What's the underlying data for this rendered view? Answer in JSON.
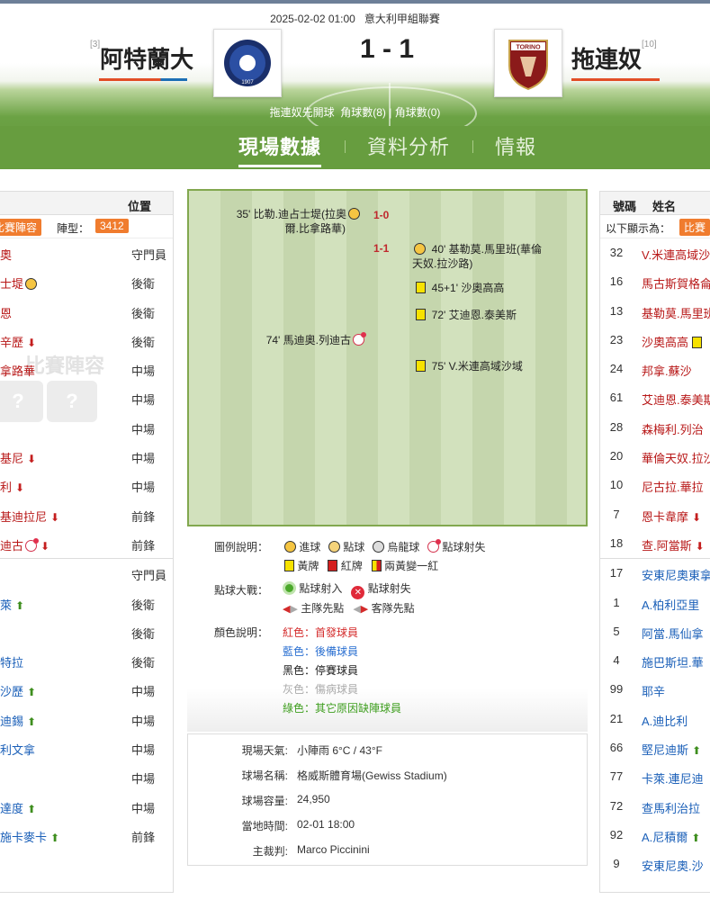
{
  "match": {
    "datetime": "2025-02-02 01:00",
    "league": "意大利甲組聯賽",
    "home": {
      "name": "阿特蘭大",
      "rank": "[3]"
    },
    "away": {
      "name": "拖連奴",
      "rank": "[10]"
    },
    "score": "1 - 1",
    "kickoff": "拖連奴先開球",
    "corners_home": "角球數(8)",
    "corners_away": "角球數(0)"
  },
  "tabs": [
    "現場數據",
    "資料分析",
    "情報"
  ],
  "left_panel": {
    "col_position": "位置",
    "lineup_tag": "比賽陣容",
    "formation_label": "陣型：",
    "formation": "3412",
    "ghost_text": "比賽陣容",
    "starters": [
      {
        "name": "奧",
        "pos": "守門員"
      },
      {
        "name": "士堤",
        "pos": "後衛",
        "icon": "goal"
      },
      {
        "name": "恩",
        "pos": "後衛"
      },
      {
        "name": "辛歷",
        "pos": "後衛",
        "sub": "down"
      },
      {
        "name": "拿路華",
        "pos": "中場"
      },
      {
        "name": "",
        "pos": "中場"
      },
      {
        "name": "",
        "pos": "中場"
      },
      {
        "name": "基尼",
        "pos": "中場",
        "sub": "down"
      },
      {
        "name": "利",
        "pos": "中場",
        "sub": "down"
      },
      {
        "name": "基迪拉尼",
        "pos": "前鋒",
        "sub": "down"
      },
      {
        "name": "迪古",
        "pos": "前鋒",
        "icon": "penmiss",
        "sub": "down"
      }
    ],
    "subs": [
      {
        "name": "",
        "pos": "守門員"
      },
      {
        "name": "萊",
        "pos": "後衛",
        "sub": "up"
      },
      {
        "name": "",
        "pos": "後衛"
      },
      {
        "name": "特拉",
        "pos": "後衛"
      },
      {
        "name": "沙歷",
        "pos": "中場",
        "sub": "up"
      },
      {
        "name": "迪錫",
        "pos": "中場",
        "sub": "up"
      },
      {
        "name": "利文拿",
        "pos": "中場"
      },
      {
        "name": "",
        "pos": "中場"
      },
      {
        "name": "達度",
        "pos": "中場",
        "sub": "up"
      },
      {
        "name": "施卡麥卡",
        "pos": "前鋒",
        "sub": "up"
      }
    ]
  },
  "timeline": {
    "events": [
      {
        "side": "home",
        "text": "35' 比勒.迪占士堤(拉奧",
        "text2": "爾.比拿路華)",
        "icon": "goal"
      },
      {
        "side": "home",
        "text": "74' 馬迪奧.列迪古",
        "icon": "penmiss"
      },
      {
        "side": "away",
        "text": "40' 基勒莫.馬里班(華倫",
        "text2": "天奴.拉沙路)",
        "icon": "goal"
      },
      {
        "side": "away",
        "text": "45+1' 沙奧高高",
        "icon": "yellow"
      },
      {
        "side": "away",
        "text": "72' 艾迪恩.泰美斯",
        "icon": "yellow"
      },
      {
        "side": "away",
        "text": "75' V.米連高域沙域",
        "icon": "yellow"
      }
    ],
    "scores": [
      "1-0",
      "1-1"
    ]
  },
  "legend": {
    "title": "圖例說明：",
    "goal": "進球",
    "penalty": "點球",
    "own_goal": "烏龍球",
    "pen_miss": "點球射失",
    "yellow": "黃牌",
    "red": "紅牌",
    "two_yellow": "兩黃變一紅",
    "shootout_title": "點球大戰：",
    "pen_in": "點球射入",
    "pen_out": "點球射失",
    "home_first": "主隊先點",
    "away_first": "客隊先點",
    "color_title": "顏色說明：",
    "red_desc": "紅色：首發球員",
    "blue_desc": "藍色：後備球員",
    "black_desc": "黑色：停賽球員",
    "grey_desc": "灰色：傷病球員",
    "green_desc": "綠色：其它原因缺陣球員",
    "colors": {
      "red": "#d42b2b",
      "blue": "#2a6fd1",
      "black": "#222222",
      "grey": "#aaaaaa",
      "green": "#3e9e1e"
    }
  },
  "info": [
    {
      "k": "現場天氣:",
      "v": "小陣雨  6°C / 43°F"
    },
    {
      "k": "球場名稱:",
      "v": "格威斯體育場(Gewiss Stadium)"
    },
    {
      "k": "球場容量:",
      "v": "24,950"
    },
    {
      "k": "當地時間:",
      "v": "02-01 18:00"
    },
    {
      "k": "主裁判:",
      "v": "Marco Piccinini"
    }
  ],
  "right_panel": {
    "col_no": "號碼",
    "col_name": "姓名",
    "note": "以下顯示為：",
    "note_tag": "比賽",
    "starters": [
      {
        "no": "32",
        "name": "V.米連高域沙"
      },
      {
        "no": "16",
        "name": "馬古斯賀格侖"
      },
      {
        "no": "13",
        "name": "基勒莫.馬里班"
      },
      {
        "no": "23",
        "name": "沙奧高高",
        "icon": "yellow"
      },
      {
        "no": "24",
        "name": "邦拿.蘇沙"
      },
      {
        "no": "61",
        "name": "艾迪恩.泰美斯"
      },
      {
        "no": "28",
        "name": "森梅利.列治"
      },
      {
        "no": "20",
        "name": "華倫天奴.拉沙"
      },
      {
        "no": "10",
        "name": "尼古拉.華拉"
      },
      {
        "no": "7",
        "name": "恩卡韋摩",
        "sub": "down"
      },
      {
        "no": "18",
        "name": "查.阿當斯",
        "sub": "down"
      }
    ],
    "subs": [
      {
        "no": "17",
        "name": "安東尼奧東拿"
      },
      {
        "no": "1",
        "name": "A.柏利亞里"
      },
      {
        "no": "5",
        "name": "阿當.馬仙拿"
      },
      {
        "no": "4",
        "name": "施巴斯坦.華"
      },
      {
        "no": "99",
        "name": "耶辛"
      },
      {
        "no": "21",
        "name": "A.迪比利"
      },
      {
        "no": "66",
        "name": "堅尼迪斯",
        "sub": "up"
      },
      {
        "no": "77",
        "name": "卡萊.連尼迪"
      },
      {
        "no": "72",
        "name": "查馬利治拉"
      },
      {
        "no": "92",
        "name": "A.尼積爾",
        "sub": "up"
      },
      {
        "no": "9",
        "name": "安東尼奧.沙"
      }
    ]
  },
  "colors": {
    "green": "#679d3f",
    "orange": "#f07c2e",
    "starter": "#b81818",
    "sub": "#1a5fb8"
  }
}
